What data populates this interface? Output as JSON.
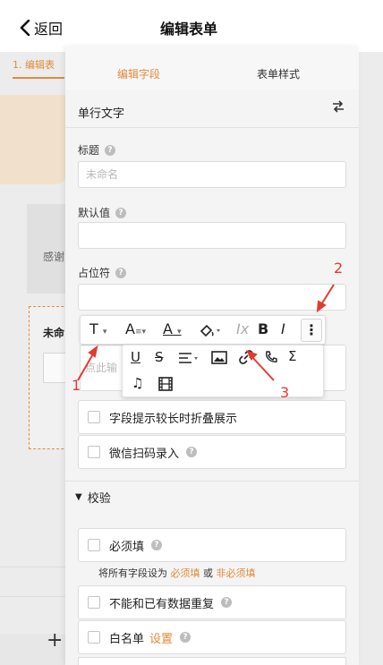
{
  "nav": {
    "back_label": "返回",
    "title": "编辑表单"
  },
  "background": {
    "tab_label": "1. 编辑表",
    "text1": "感谢",
    "text2": "未命"
  },
  "panel": {
    "tabs": [
      {
        "label": "编辑字段"
      },
      {
        "label": "表单样式"
      }
    ],
    "field_type": "单行文字",
    "labels": {
      "title": "标题",
      "default": "默认值",
      "placeholder": "占位符"
    },
    "title_placeholder": "未命名",
    "editor_placeholder": "点此输",
    "options": {
      "collapse_hint": "字段提示较长时折叠展示",
      "wechat_scan": "微信扫码录入"
    },
    "verify": {
      "title": "校验",
      "required": "必须填",
      "hint_prefix": "将所有字段设为",
      "hint_required": "必须填",
      "hint_or": "或",
      "hint_optional": "非必须填",
      "no_duplicate": "不能和已有数据重复",
      "whitelist": "白名单",
      "whitelist_link": "设置"
    }
  },
  "toolbar": {
    "text": "T",
    "size": "A",
    "color": "A",
    "more": "⋮"
  },
  "annotations": [
    "1",
    "2",
    "3"
  ],
  "colors": {
    "accent": "#e08a3a",
    "annotation": "#e53a2e"
  }
}
